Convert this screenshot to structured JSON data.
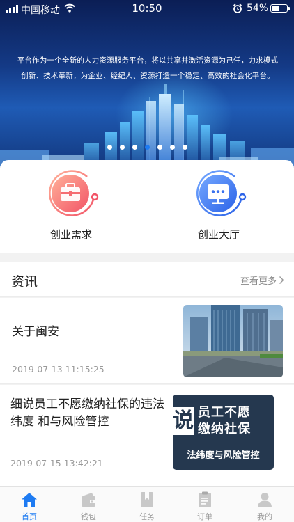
{
  "status_bar": {
    "carrier": "中国移动",
    "time": "10:50",
    "battery": "54%",
    "battery_level": 0.54
  },
  "banner": {
    "text_line1": "平台作为一个全新的人力资源服务平台，将以共享并激活资源为己任，力求模式",
    "text_line2": "创新、技术革新，为企业、经纪人、资源打造一个稳定、高效的社会化平台。",
    "slide_count": 7,
    "active_slide": 3
  },
  "actions": [
    {
      "label": "创业需求",
      "icon": "briefcase-icon",
      "color": "#f26b6b"
    },
    {
      "label": "创业大厅",
      "icon": "monitor-icon",
      "color": "#3f7bf0"
    }
  ],
  "news": {
    "title": "资讯",
    "more_label": "查看更多",
    "items": [
      {
        "title": "关于闽安",
        "date": "2019-07-13 11:15:25",
        "image": "building-photo"
      },
      {
        "title": "细说员工不愿缴纳社保的违法纬度 和与风险管控",
        "date": "2019-07-15 13:42:21",
        "image": "social-insurance-graphic",
        "image_text": [
          "员工不愿",
          "缴纳社保",
          "法纬度与风险管控"
        ],
        "image_glyph": "说"
      }
    ]
  },
  "tabbar": [
    {
      "label": "首页",
      "icon": "home-icon",
      "active": true
    },
    {
      "label": "钱包",
      "icon": "wallet-icon",
      "active": false
    },
    {
      "label": "任务",
      "icon": "bookmark-icon",
      "active": false
    },
    {
      "label": "订单",
      "icon": "clipboard-icon",
      "active": false
    },
    {
      "label": "我的",
      "icon": "user-icon",
      "active": false
    }
  ],
  "colors": {
    "accent": "#1e7bf2",
    "inactive": "#999999"
  }
}
